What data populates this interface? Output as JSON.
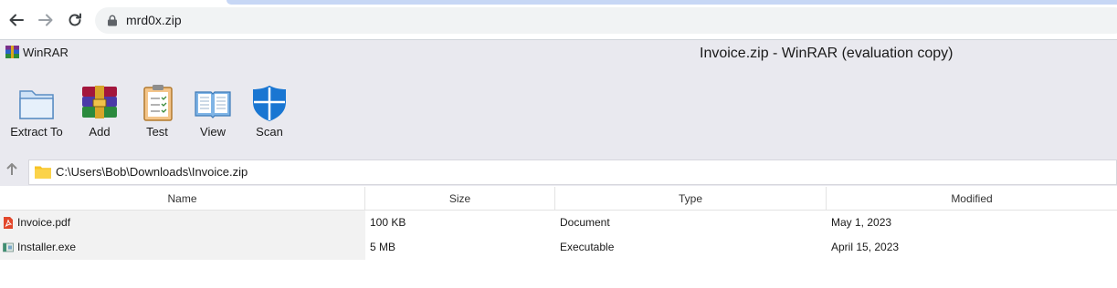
{
  "browser": {
    "url": "mrd0x.zip",
    "icons": [
      "back-arrow-icon",
      "forward-arrow-icon",
      "reload-icon",
      "lock-icon"
    ]
  },
  "app": {
    "name": "WinRAR",
    "window_title": "Invoice.zip - WinRAR (evaluation copy)"
  },
  "toolbar": {
    "extract_label": "Extract To",
    "add_label": "Add",
    "test_label": "Test",
    "view_label": "View",
    "scan_label": "Scan"
  },
  "address": {
    "path": "C:\\Users\\Bob\\Downloads\\Invoice.zip"
  },
  "list": {
    "columns": [
      "Name",
      "Size",
      "Type",
      "Modified"
    ],
    "rows": [
      {
        "name": "Invoice.pdf",
        "size": "100 KB",
        "type": "Document",
        "modified": "May 1, 2023",
        "icon": "pdf-icon"
      },
      {
        "name": "Installer.exe",
        "size": "5 MB",
        "type": "Executable",
        "modified": "April 15, 2023",
        "icon": "exe-icon"
      }
    ]
  },
  "colors": {
    "window_bg": "#e9e9ef",
    "shield_blue": "#1976d2",
    "folder_yellow": "#f7c325",
    "pdf_red": "#e2472b"
  }
}
